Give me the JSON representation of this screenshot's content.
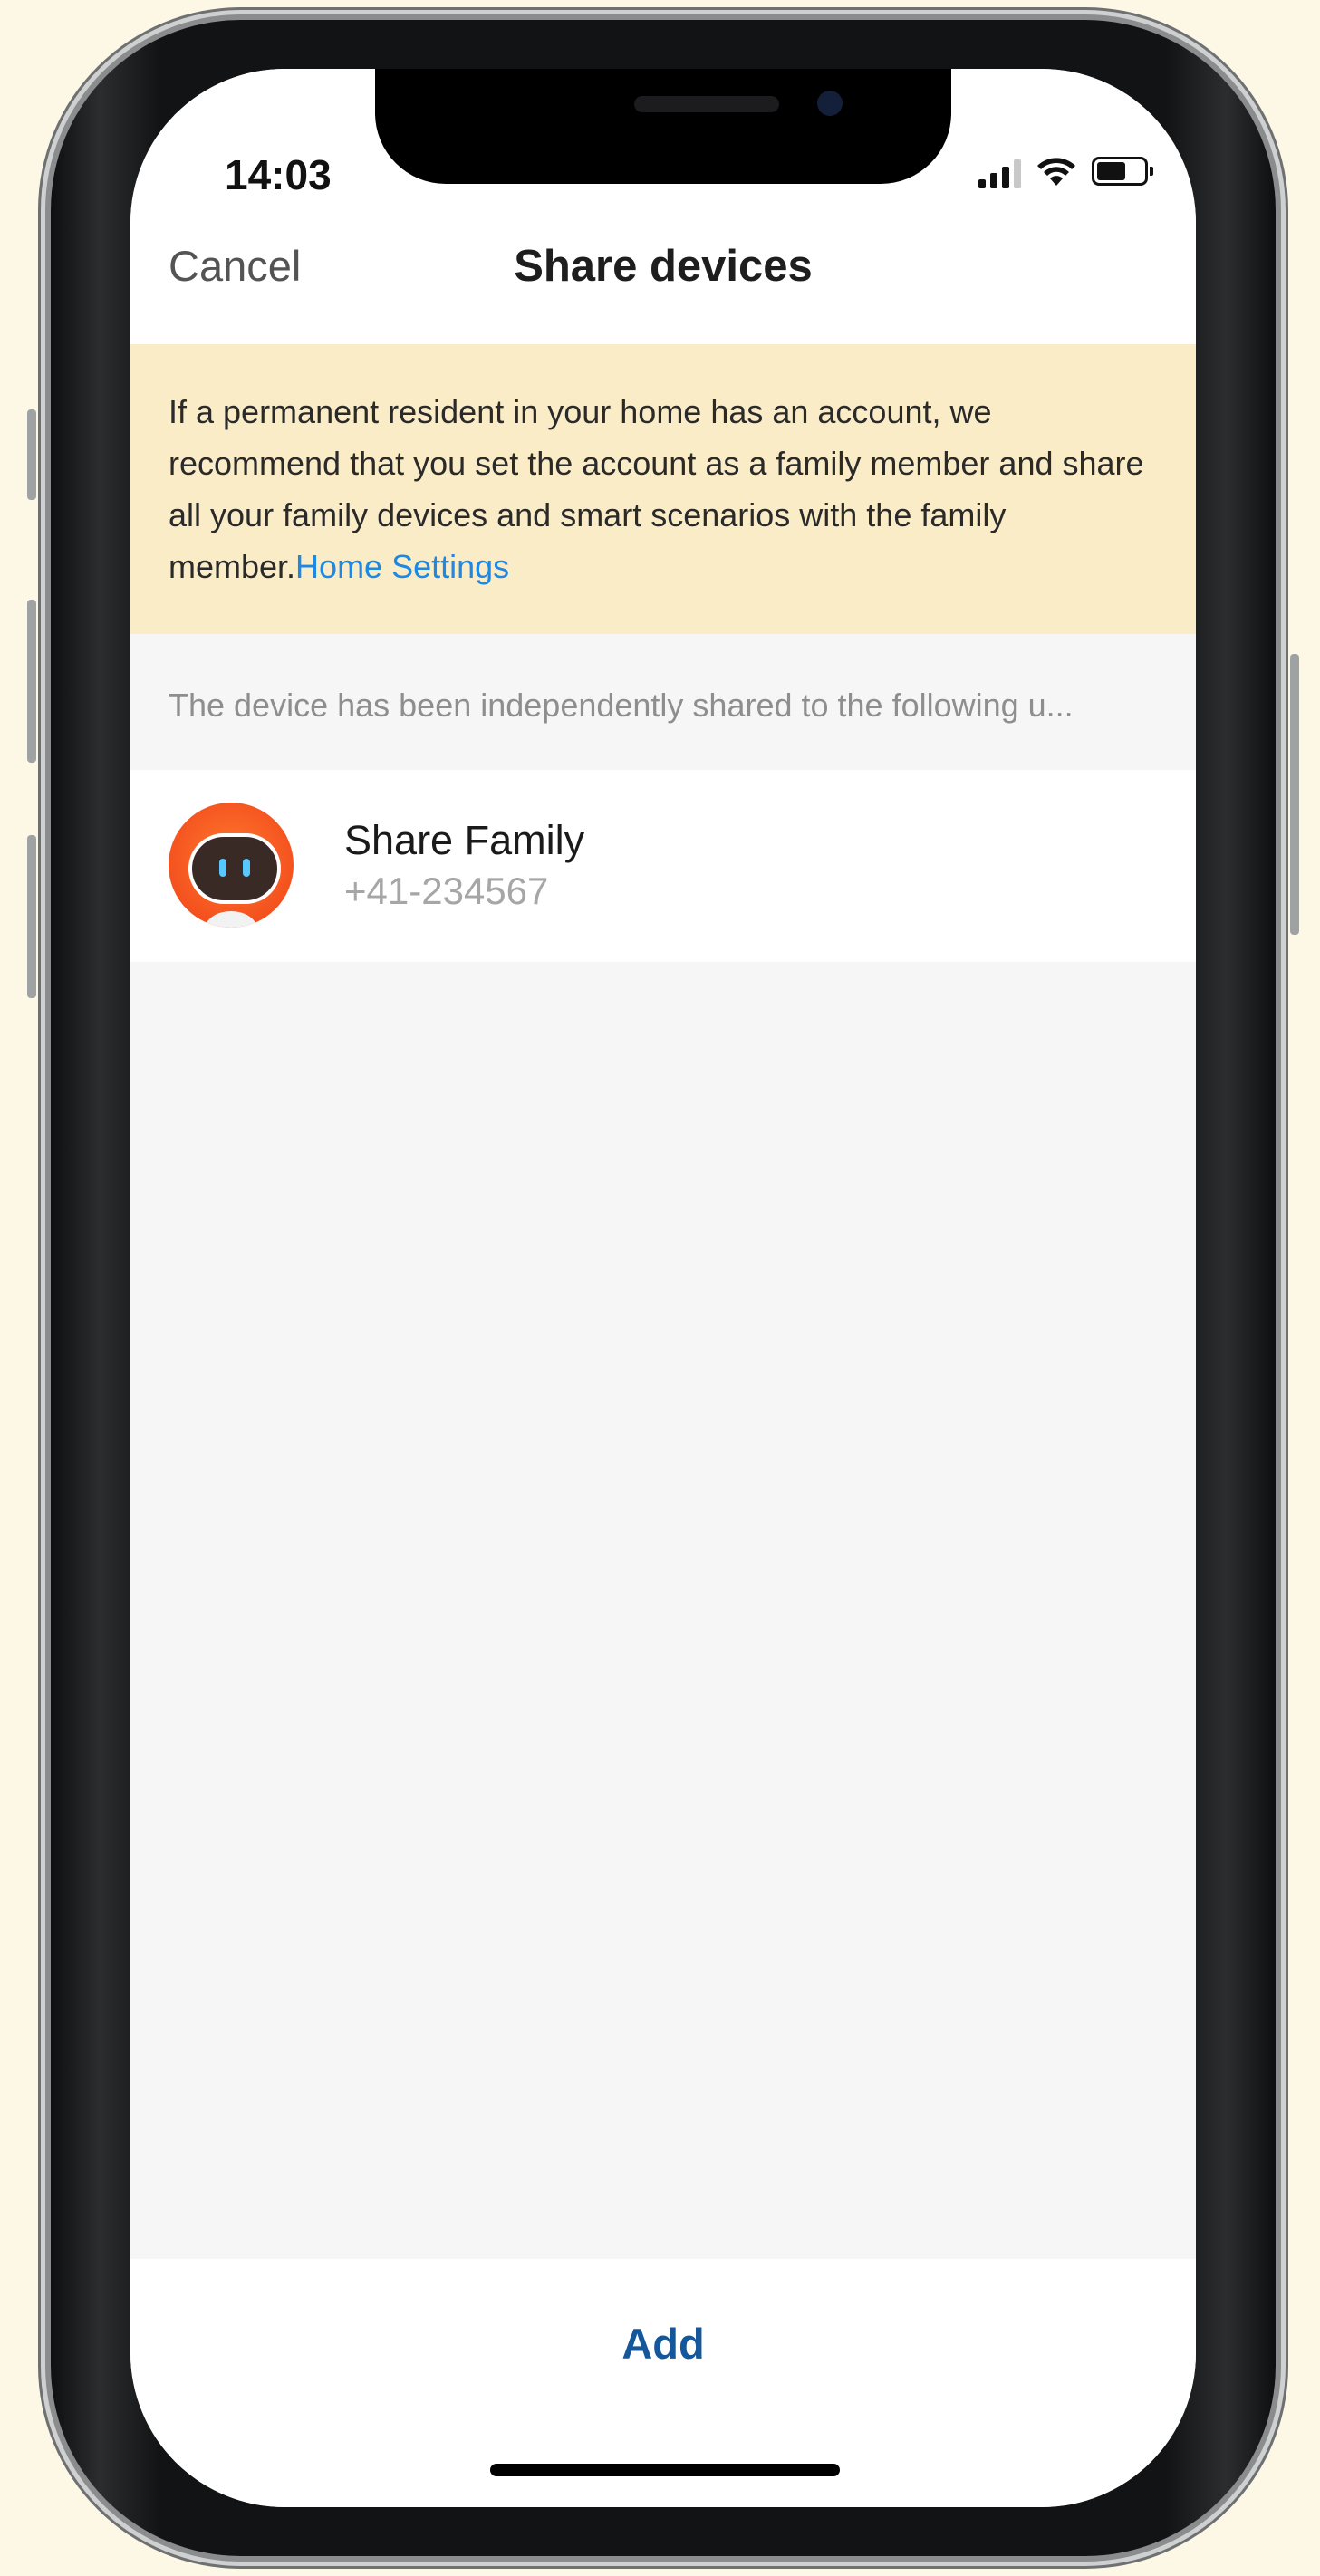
{
  "status_bar": {
    "time": "14:03"
  },
  "nav": {
    "cancel_label": "Cancel",
    "title": "Share devices"
  },
  "notice": {
    "text": "If a permanent resident in your home has an account, we recommend that you set the account as a family member and share all your family devices and smart scenarios with the family member.",
    "link_label": "Home Settings"
  },
  "shared_list": {
    "header": "The device has been independently shared to the following u...",
    "items": [
      {
        "name": "Share Family",
        "phone": "+41-234567"
      }
    ]
  },
  "footer": {
    "add_label": "Add"
  },
  "colors": {
    "link": "#1e88e5",
    "accent_button": "#14579a",
    "notice_bg": "#faecc6"
  }
}
